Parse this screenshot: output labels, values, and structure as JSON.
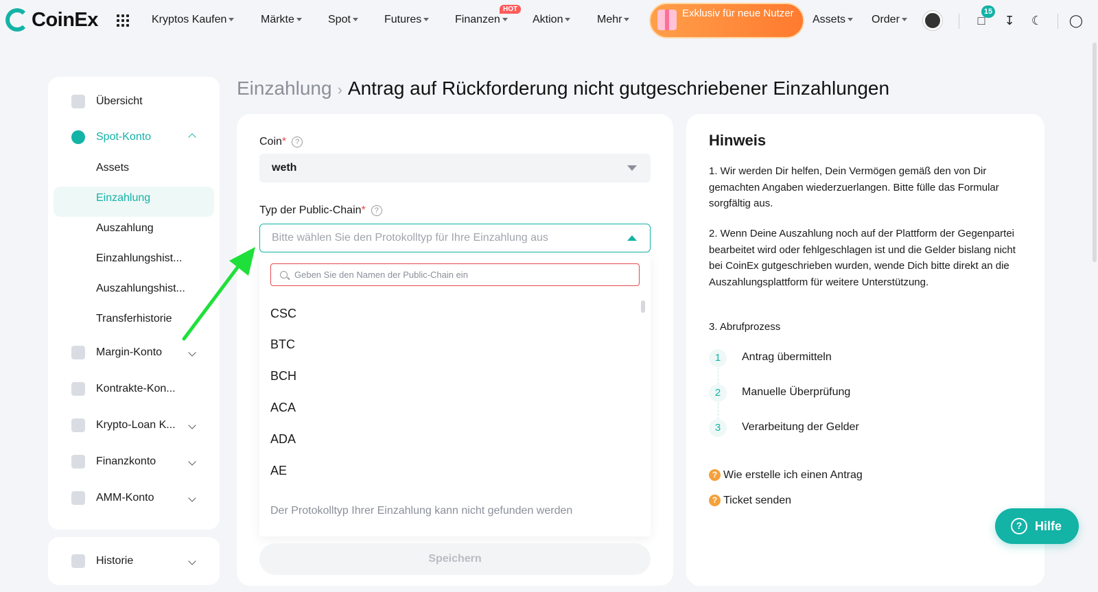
{
  "brand": {
    "name": "CoinEx",
    "accent": "#13b3a6"
  },
  "nav": {
    "items": [
      "Kryptos Kaufen",
      "Märkte",
      "Spot",
      "Futures",
      "Finanzen",
      "Aktion",
      "Mehr"
    ],
    "hot_badge": "HOT",
    "promo": "Exklusiv für neue Nutzer",
    "right_items": [
      "Assets",
      "Order"
    ],
    "notification_count": "15"
  },
  "sidebar": {
    "overview": "Übersicht",
    "spot_account": "Spot-Konto",
    "sub_items": [
      "Assets",
      "Einzahlung",
      "Auszahlung",
      "Einzahlungshist...",
      "Auszahlungshist...",
      "Transferhistorie"
    ],
    "active_sub": "Einzahlung",
    "sections": [
      "Margin-Konto",
      "Kontrakte-Kon...",
      "Krypto-Loan K...",
      "Finanzkonto",
      "AMM-Konto"
    ],
    "history": "Historie"
  },
  "breadcrumb": {
    "parent": "Einzahlung",
    "current": "Antrag auf Rückforderung nicht gutgeschriebener Einzahlungen"
  },
  "form": {
    "coin_label": "Coin",
    "coin_value": "weth",
    "chain_label": "Typ der Public-Chain",
    "chain_placeholder": "Bitte wählen Sie den Protokolltyp für Ihre Einzahlung aus",
    "search_placeholder": "Geben Sie den Namen der Public-Chain ein",
    "options": [
      "CSC",
      "BTC",
      "BCH",
      "ACA",
      "ADA",
      "AE"
    ],
    "not_found": "Der Protokolltyp Ihrer Einzahlung kann nicht gefunden werden",
    "save": "Speichern"
  },
  "hint": {
    "title": "Hinweis",
    "p1": "1. Wir werden Dir helfen, Dein Vermögen gemäß den von Dir gemachten Angaben wiederzuerlangen. Bitte fülle das Formular sorgfältig aus.",
    "p2": "2. Wenn Deine Auszahlung noch auf der Plattform der Gegenpartei bearbeitet wird oder fehlgeschlagen ist und die Gelder bislang nicht bei CoinEx gutgeschrieben wurden, wende Dich bitte direkt an die Auszahlungsplattform für weitere Unterstützung.",
    "p3": "3. Abrufprozess",
    "steps": [
      {
        "num": "1",
        "label": "Antrag übermitteln"
      },
      {
        "num": "2",
        "label": "Manuelle Überprüfung"
      },
      {
        "num": "3",
        "label": "Verarbeitung der Gelder"
      }
    ],
    "faq1": "Wie erstelle ich einen Antrag",
    "faq2": "Ticket senden"
  },
  "help": "Hilfe"
}
